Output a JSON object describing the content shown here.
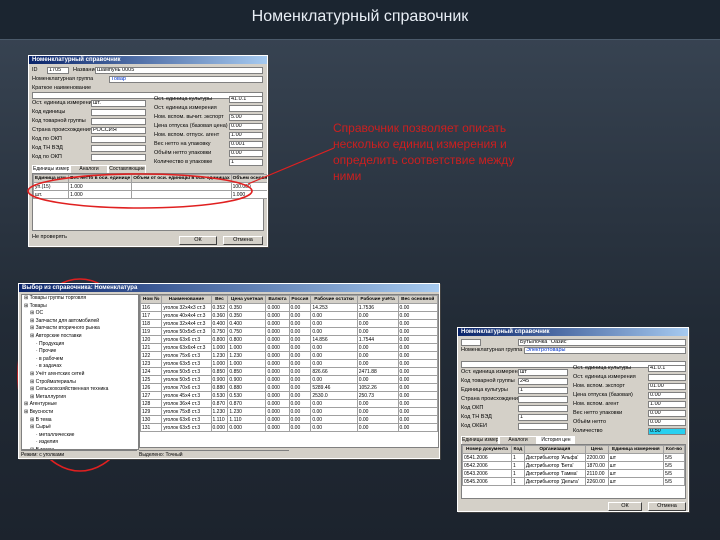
{
  "slide": {
    "title": "Номенклатурный справочник",
    "note": "Справочник позволяет описать несколько единиц измерения и определить соответствие между ними"
  },
  "win1": {
    "title": "Номенклатурный справочник",
    "id_label": "ID",
    "id_value": "1705",
    "name_label": "Название",
    "name_value": "Шампунь 0005",
    "group_label": "Номенклатурная группа",
    "group_value": "Товар",
    "short_label": "Краткое наименование",
    "left_fields": [
      {
        "label": "Ост. единица измерения",
        "value": "шт."
      },
      {
        "label": "Код единицы",
        "value": ""
      },
      {
        "label": "Код товарной группы",
        "value": ""
      },
      {
        "label": "Страна происхождения",
        "value": "РОССИЯ"
      },
      {
        "label": "Код по ОКП",
        "value": ""
      },
      {
        "label": "Код ТН ВЭД",
        "value": ""
      },
      {
        "label": "Код по ОКП",
        "value": ""
      }
    ],
    "right_fields": [
      {
        "label": "Ост. единица культуры",
        "value": "41.0.1"
      },
      {
        "label": "Ост. единица измерения",
        "value": ""
      },
      {
        "label": "Ном. вспом. вычит. экспорт",
        "value": "5.00"
      },
      {
        "label": "Цена отпуска (базовая цена)",
        "value": "0.00"
      },
      {
        "label": "Ном. вспом. отпуск. агент",
        "value": "1.00"
      },
      {
        "label": "Вес нетто на упаковку",
        "value": "0.001"
      },
      {
        "label": "Объём нетто упаковки",
        "value": "0.00"
      },
      {
        "label": "Количество в упаковке",
        "value": "1"
      }
    ],
    "tabs": [
      "Единицы измерения",
      "Аналоги",
      "Составляющие"
    ],
    "grid_headers": [
      "Единица изм.",
      "Вес нетто в оси. единице",
      "Объем от оси. единицы в оси. единицах",
      "Объем основной единицы в этой единице",
      "Вес единиц в шт.",
      "Штрихкод"
    ],
    "grid_rows": [
      [
        "уп.(15)",
        "1.000",
        "100.000",
        "ОВ 0021734"
      ],
      [
        "шт.",
        "1.000",
        "1.000",
        "ПОЛУЧЕН"
      ]
    ],
    "footer_check": "Не проверять",
    "ok": "ОК",
    "cancel": "Отмена"
  },
  "win2": {
    "title": "Выбор из справочника: Номенклатура",
    "tree": [
      "Товары группы торговля",
      "Товары",
      "ОС",
      "Запчасти для автомобилей",
      "Запчасти вторичного рынка",
      "Авторские поставки",
      "Продукция",
      "Прочие",
      "в рабочем",
      "в задачах",
      "Учёт агентских сетей",
      "Стройматериалы",
      "Сельскохозяйственная техника",
      "Металлургия",
      "Агентурные",
      "Вкусности",
      "В тема",
      "Сырьё",
      "металлические",
      "изделия",
      "В темах",
      "в сетевых торговых",
      "изделия",
      "в пути"
    ],
    "headers": [
      "Ном №",
      "Наименование",
      "Вес",
      "Цена учетная",
      "Валюта",
      "Россия",
      "Рабочие остатки",
      "Рабочие учёта",
      "Вес основной"
    ],
    "rows": [
      [
        "116",
        "уголок 32х4х3 ст.3",
        "0.352",
        "0.350",
        "0.000",
        "0.00",
        "14.253",
        "1.7536",
        "0.00"
      ],
      [
        "117",
        "уголок 40х4х4 ст.3",
        "0.360",
        "0.350",
        "0.000",
        "0.00",
        "0.00",
        "0.00",
        "0.00"
      ],
      [
        "118",
        "уголок 32х4х4 ст.3",
        "0.400",
        "0.400",
        "0.000",
        "0.00",
        "0.00",
        "0.00",
        "0.00"
      ],
      [
        "119",
        "уголок 50х5х5 ст.3",
        "0.750",
        "0.750",
        "0.000",
        "0.00",
        "0.00",
        "0.00",
        "0.00"
      ],
      [
        "120",
        "уголок 63х6 ст.3",
        "0.800",
        "0.800",
        "0.000",
        "0.00",
        "14.856",
        "1.7544",
        "0.00"
      ],
      [
        "121",
        "уголок 63х6х4 ст.3",
        "1.000",
        "1.000",
        "0.000",
        "0.00",
        "0.00",
        "0.00",
        "0.00"
      ],
      [
        "122",
        "уголок 75х6 ст.3",
        "1.230",
        "1.230",
        "0.000",
        "0.00",
        "0.00",
        "0.00",
        "0.00"
      ],
      [
        "123",
        "уголок 63х5 ст.3",
        "1.000",
        "1.000",
        "0.000",
        "0.00",
        "0.00",
        "0.00",
        "0.00"
      ],
      [
        "124",
        "уголок 50х5 ст.3",
        "0.850",
        "0.850",
        "0.000",
        "0.00",
        "826.66",
        "2471.88",
        "0.00"
      ],
      [
        "125",
        "уголок 50х5 ст.3",
        "0.900",
        "0.900",
        "0.000",
        "0.00",
        "0.00",
        "0.00",
        "0.00"
      ],
      [
        "126",
        "уголок 70х6 ст.3",
        "0.880",
        "0.880",
        "0.000",
        "0.00",
        "5289.46",
        "1052.26",
        "0.00"
      ],
      [
        "127",
        "уголок 45х4 ст.3",
        "0.530",
        "0.530",
        "0.000",
        "0.00",
        "2530.0",
        "250.73",
        "0.00"
      ],
      [
        "128",
        "уголок 36х4 ст.3",
        "0.870",
        "0.870",
        "0.000",
        "0.00",
        "0.00",
        "0.00",
        "0.00"
      ],
      [
        "129",
        "уголок 75х8 ст.3",
        "1.230",
        "1.230",
        "0.000",
        "0.00",
        "0.00",
        "0.00",
        "0.00"
      ],
      [
        "130",
        "уголок 63х6 ст.3",
        "1.110",
        "1.110",
        "0.000",
        "0.00",
        "0.00",
        "0.00",
        "0.00"
      ],
      [
        "131",
        "уголок 63х5 ст.3",
        "0.000",
        "0.000",
        "0.000",
        "0.00",
        "0.00",
        "0.00",
        "0.00"
      ]
    ],
    "status_left": "Режим: с уголками",
    "status_right": "Выделено: Точный"
  },
  "win3": {
    "title": "Номенклатурный справочник",
    "group_label": "Номенклатурная группа",
    "group_value": "Электротовары",
    "name_value": "Бутылочка \"Оазис\"",
    "left_fields": [
      {
        "label": "Ост. единица измерения",
        "value": "шт"
      },
      {
        "label": "Код товарной группы",
        "value": "245"
      },
      {
        "label": "Единица культуры",
        "value": "1"
      },
      {
        "label": "Страна происхождения",
        "value": ""
      },
      {
        "label": "Код ОКП",
        "value": ""
      },
      {
        "label": "Код ТН ВЭД",
        "value": "1"
      },
      {
        "label": "Код ОКЕИ",
        "value": ""
      }
    ],
    "right_fields": [
      {
        "label": "Ост. единица культуры",
        "value": "41.0.1"
      },
      {
        "label": "Ост. единица измерения",
        "value": ""
      },
      {
        "label": "Ном. вспом. экспорт",
        "value": "01.00"
      },
      {
        "label": "Цена отпуска (базовая)",
        "value": "0.00"
      },
      {
        "label": "Ном. вспом. агент",
        "value": "1.00"
      },
      {
        "label": "Вес нетто упаковки",
        "value": "0.00"
      },
      {
        "label": "Объём нетто",
        "value": "0.00"
      },
      {
        "label": "Количество",
        "value": "0.50"
      }
    ],
    "tabs": [
      "Единицы измерения",
      "Аналоги",
      "История цен"
    ],
    "headers": [
      "Номер документа",
      "Код",
      "Организация",
      "Цена",
      "Единица измерения",
      "Кол-во"
    ],
    "rows": [
      [
        "0541.2006",
        "1",
        "Дистрибьютор 'Альфа'",
        "2200.00",
        "шт",
        "5/5"
      ],
      [
        "0542.2006",
        "1",
        "Дистрибьютор 'Бета'",
        "1870.00",
        "шт",
        "5/5"
      ],
      [
        "0543.2006",
        "1",
        "Дистрибьютор 'Гамма'",
        "2110.00",
        "шт",
        "5/5"
      ],
      [
        "0545.2006",
        "1",
        "Дистрибьютор 'Дельта'",
        "2260.00",
        "шт",
        "5/5"
      ]
    ],
    "ok": "ОК",
    "cancel": "Отмена"
  }
}
